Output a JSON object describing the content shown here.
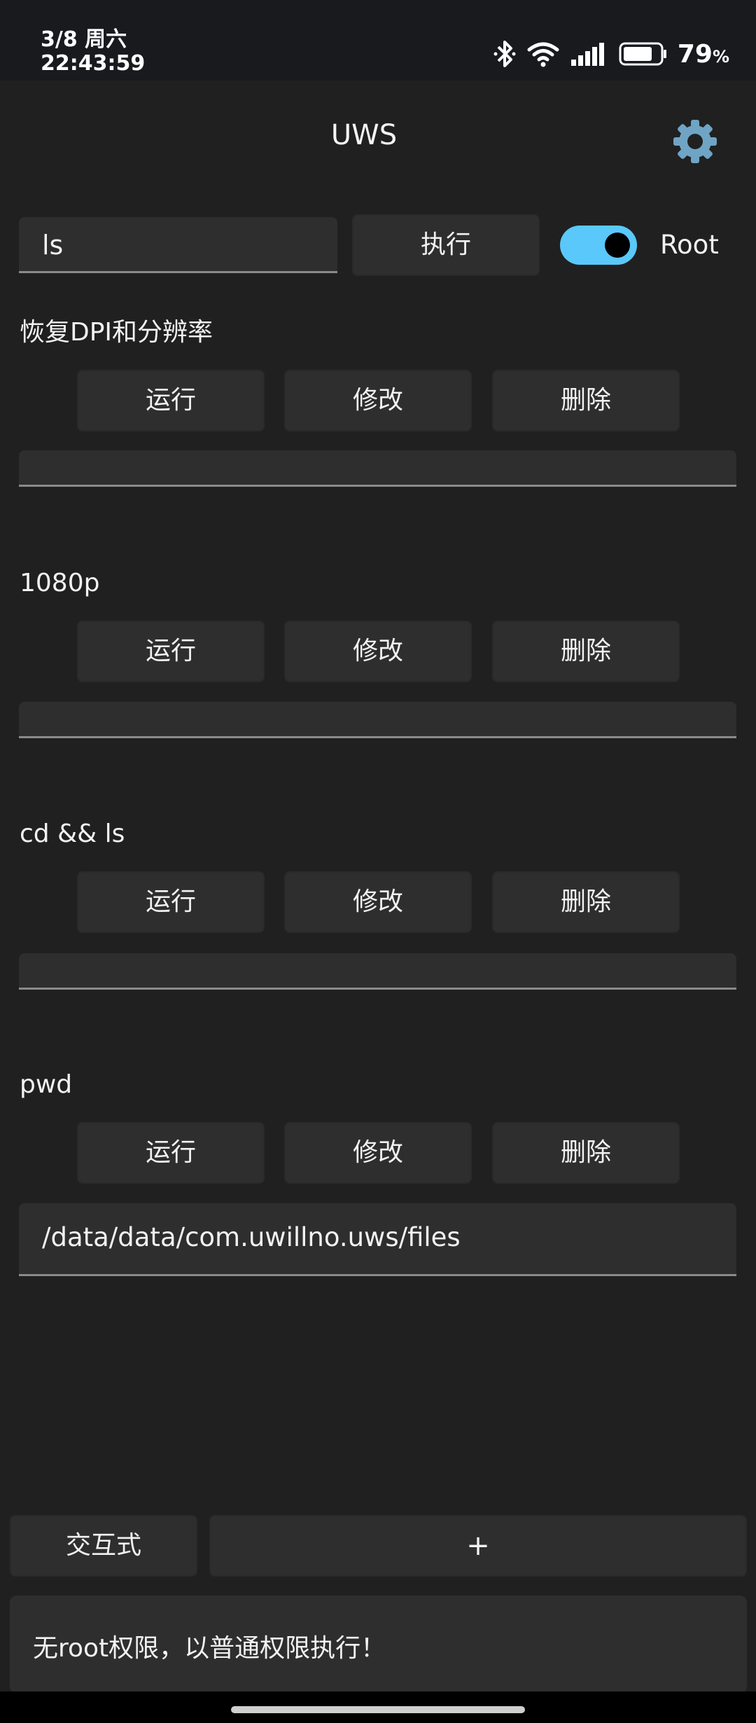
{
  "status_bar": {
    "date": "3/8 周六",
    "time": "22:43:59",
    "battery_percent": "79",
    "battery_unit": "%",
    "battery_level": 0.79
  },
  "app": {
    "title": "UWS"
  },
  "command_bar": {
    "input_value": "ls",
    "execute_label": "执行",
    "root_label": "Root",
    "root_enabled": true
  },
  "commands": [
    {
      "title": "恢复DPI和分辨率",
      "run": "运行",
      "edit": "修改",
      "delete": "删除",
      "output": ""
    },
    {
      "title": "1080p",
      "run": "运行",
      "edit": "修改",
      "delete": "删除",
      "output": ""
    },
    {
      "title": "cd && ls",
      "run": "运行",
      "edit": "修改",
      "delete": "删除",
      "output": ""
    },
    {
      "title": "pwd",
      "run": "运行",
      "edit": "修改",
      "delete": "删除",
      "output": "/data/data/com.uwillno.uws/files"
    }
  ],
  "bottom": {
    "interactive_label": "交互式",
    "add_label": "+",
    "log_message": "无root权限，以普通权限执行！"
  },
  "colors": {
    "accent": "#5ac8fa",
    "background": "#202020",
    "surface": "#2e2e2e"
  },
  "icons": [
    "bluetooth-icon",
    "wifi-icon",
    "signal-icon",
    "battery-icon",
    "gear-icon"
  ]
}
